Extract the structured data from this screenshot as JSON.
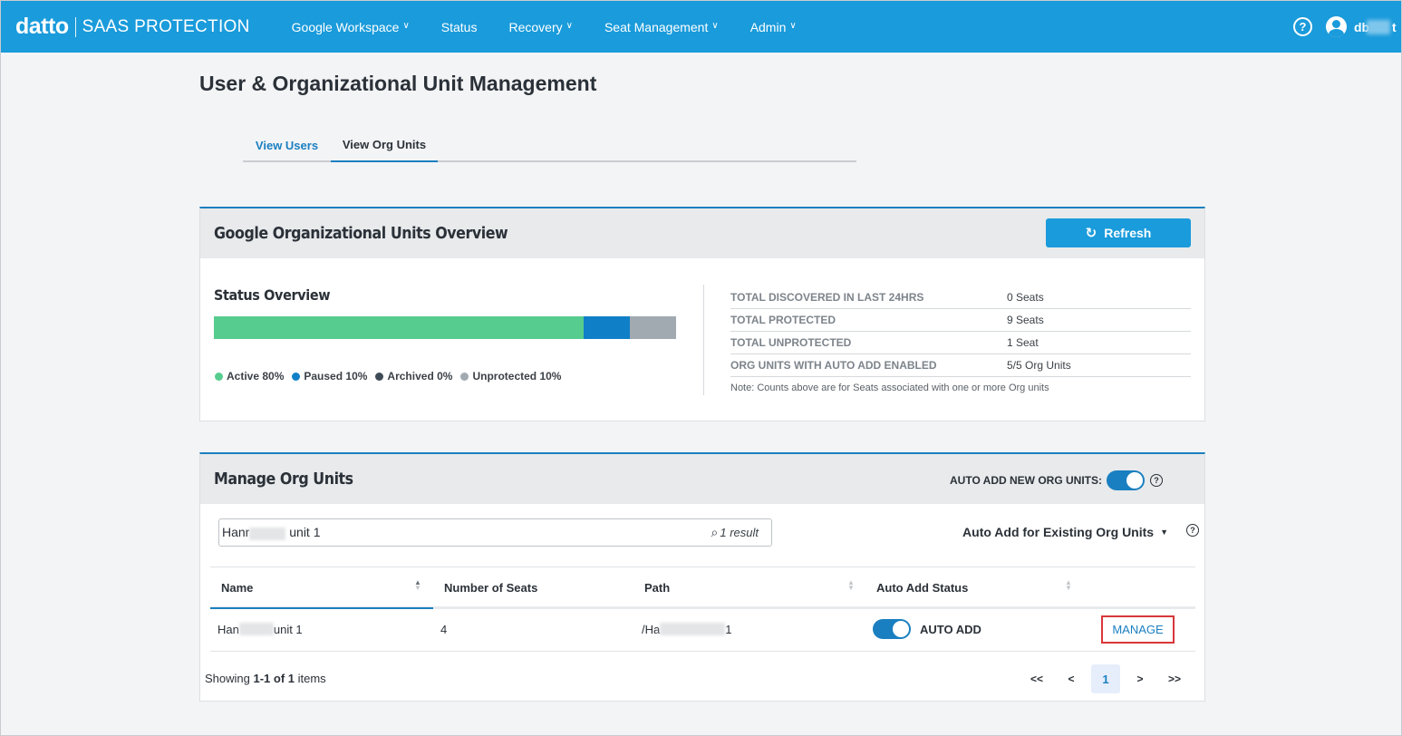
{
  "brand": {
    "logo": "datto",
    "product": "SAAS PROTECTION"
  },
  "nav": {
    "items": [
      {
        "label": "Google Workspace",
        "dropdown": true
      },
      {
        "label": "Status",
        "dropdown": false
      },
      {
        "label": "Recovery",
        "dropdown": true
      },
      {
        "label": "Seat Management",
        "dropdown": true
      },
      {
        "label": "Admin",
        "dropdown": true
      }
    ],
    "help_icon": "?",
    "user_visible_prefix": "db",
    "user_visible_suffix": "t"
  },
  "page": {
    "title": "User & Organizational Unit Management"
  },
  "tabs": [
    {
      "label": "View Users",
      "active": false
    },
    {
      "label": "View Org Units",
      "active": true
    }
  ],
  "overview": {
    "title": "Google Organizational Units Overview",
    "refresh_label": "Refresh",
    "status_title": "Status Overview",
    "status": [
      {
        "label": "Active 80%",
        "percent": 80,
        "color": "#57cc8f"
      },
      {
        "label": "Paused 10%",
        "percent": 10,
        "color": "#0f80c8"
      },
      {
        "label": "Archived 0%",
        "percent": 0,
        "color": "#3e4b57"
      },
      {
        "label": "Unprotected 10%",
        "percent": 10,
        "color": "#a2aab1"
      }
    ],
    "stats": [
      {
        "label": "TOTAL DISCOVERED IN LAST 24HRS",
        "value": "0 Seats"
      },
      {
        "label": "TOTAL PROTECTED",
        "value": "9 Seats"
      },
      {
        "label": "TOTAL UNPROTECTED",
        "value": "1 Seat"
      },
      {
        "label": "ORG UNITS WITH AUTO ADD ENABLED",
        "value": "5/5 Org Units"
      }
    ],
    "note": "Note: Counts above are for Seats associated with one or more Org units"
  },
  "manage": {
    "title": "Manage Org Units",
    "auto_add_new_label": "AUTO ADD NEW ORG UNITS:",
    "auto_add_new_on": true,
    "search_value_prefix": "Hanr",
    "search_value_suffix": " unit 1",
    "search_result": "1 result",
    "existing_dropdown": "Auto Add for Existing Org Units",
    "columns": [
      "Name",
      "Number of Seats",
      "Path",
      "Auto Add Status"
    ],
    "rows": [
      {
        "name_prefix": "Han",
        "name_suffix": " unit 1",
        "seats": "4",
        "path_prefix": "/Ha",
        "path_suffix": " 1",
        "auto_add_label": "AUTO ADD",
        "auto_add_on": true,
        "action": "MANAGE"
      }
    ],
    "showing_prefix": "Showing ",
    "showing_range": "1-1 of 1",
    "showing_suffix": " items",
    "pager": {
      "first": "<<",
      "prev": "<",
      "current": "1",
      "next": ">",
      "last": ">>"
    }
  }
}
